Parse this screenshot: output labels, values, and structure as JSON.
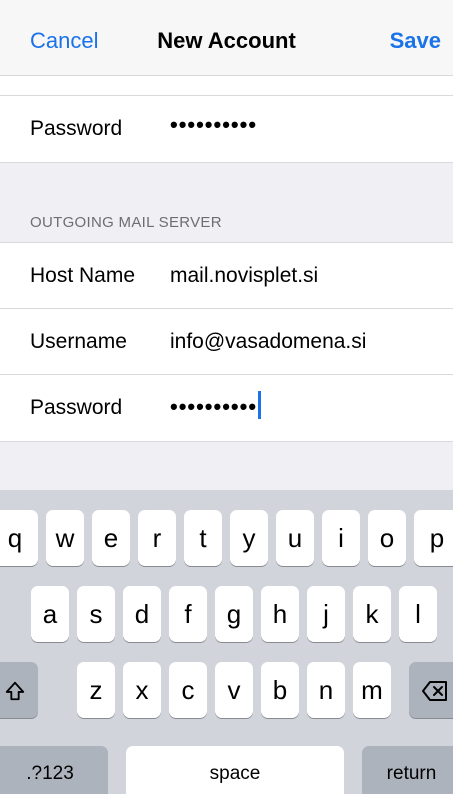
{
  "nav": {
    "cancel": "Cancel",
    "title": "New Account",
    "save": "Save"
  },
  "incoming": {
    "password_label": "Password",
    "password_value": "••••••••••"
  },
  "outgoing": {
    "header": "OUTGOING MAIL SERVER",
    "host_label": "Host Name",
    "host_value": "mail.novisplet.si",
    "username_label": "Username",
    "username_value": "info@vasadomena.si",
    "password_label": "Password",
    "password_value": "••••••••••"
  },
  "keyboard": {
    "row1": [
      "q",
      "w",
      "e",
      "r",
      "t",
      "y",
      "u",
      "i",
      "o",
      "p"
    ],
    "row2": [
      "a",
      "s",
      "d",
      "f",
      "g",
      "h",
      "j",
      "k",
      "l"
    ],
    "row3": [
      "z",
      "x",
      "c",
      "v",
      "b",
      "n",
      "m"
    ],
    "shift_icon": "shift-icon",
    "delete_icon": "delete-icon",
    "numbers": ".?123",
    "space": "space",
    "return": "return"
  }
}
